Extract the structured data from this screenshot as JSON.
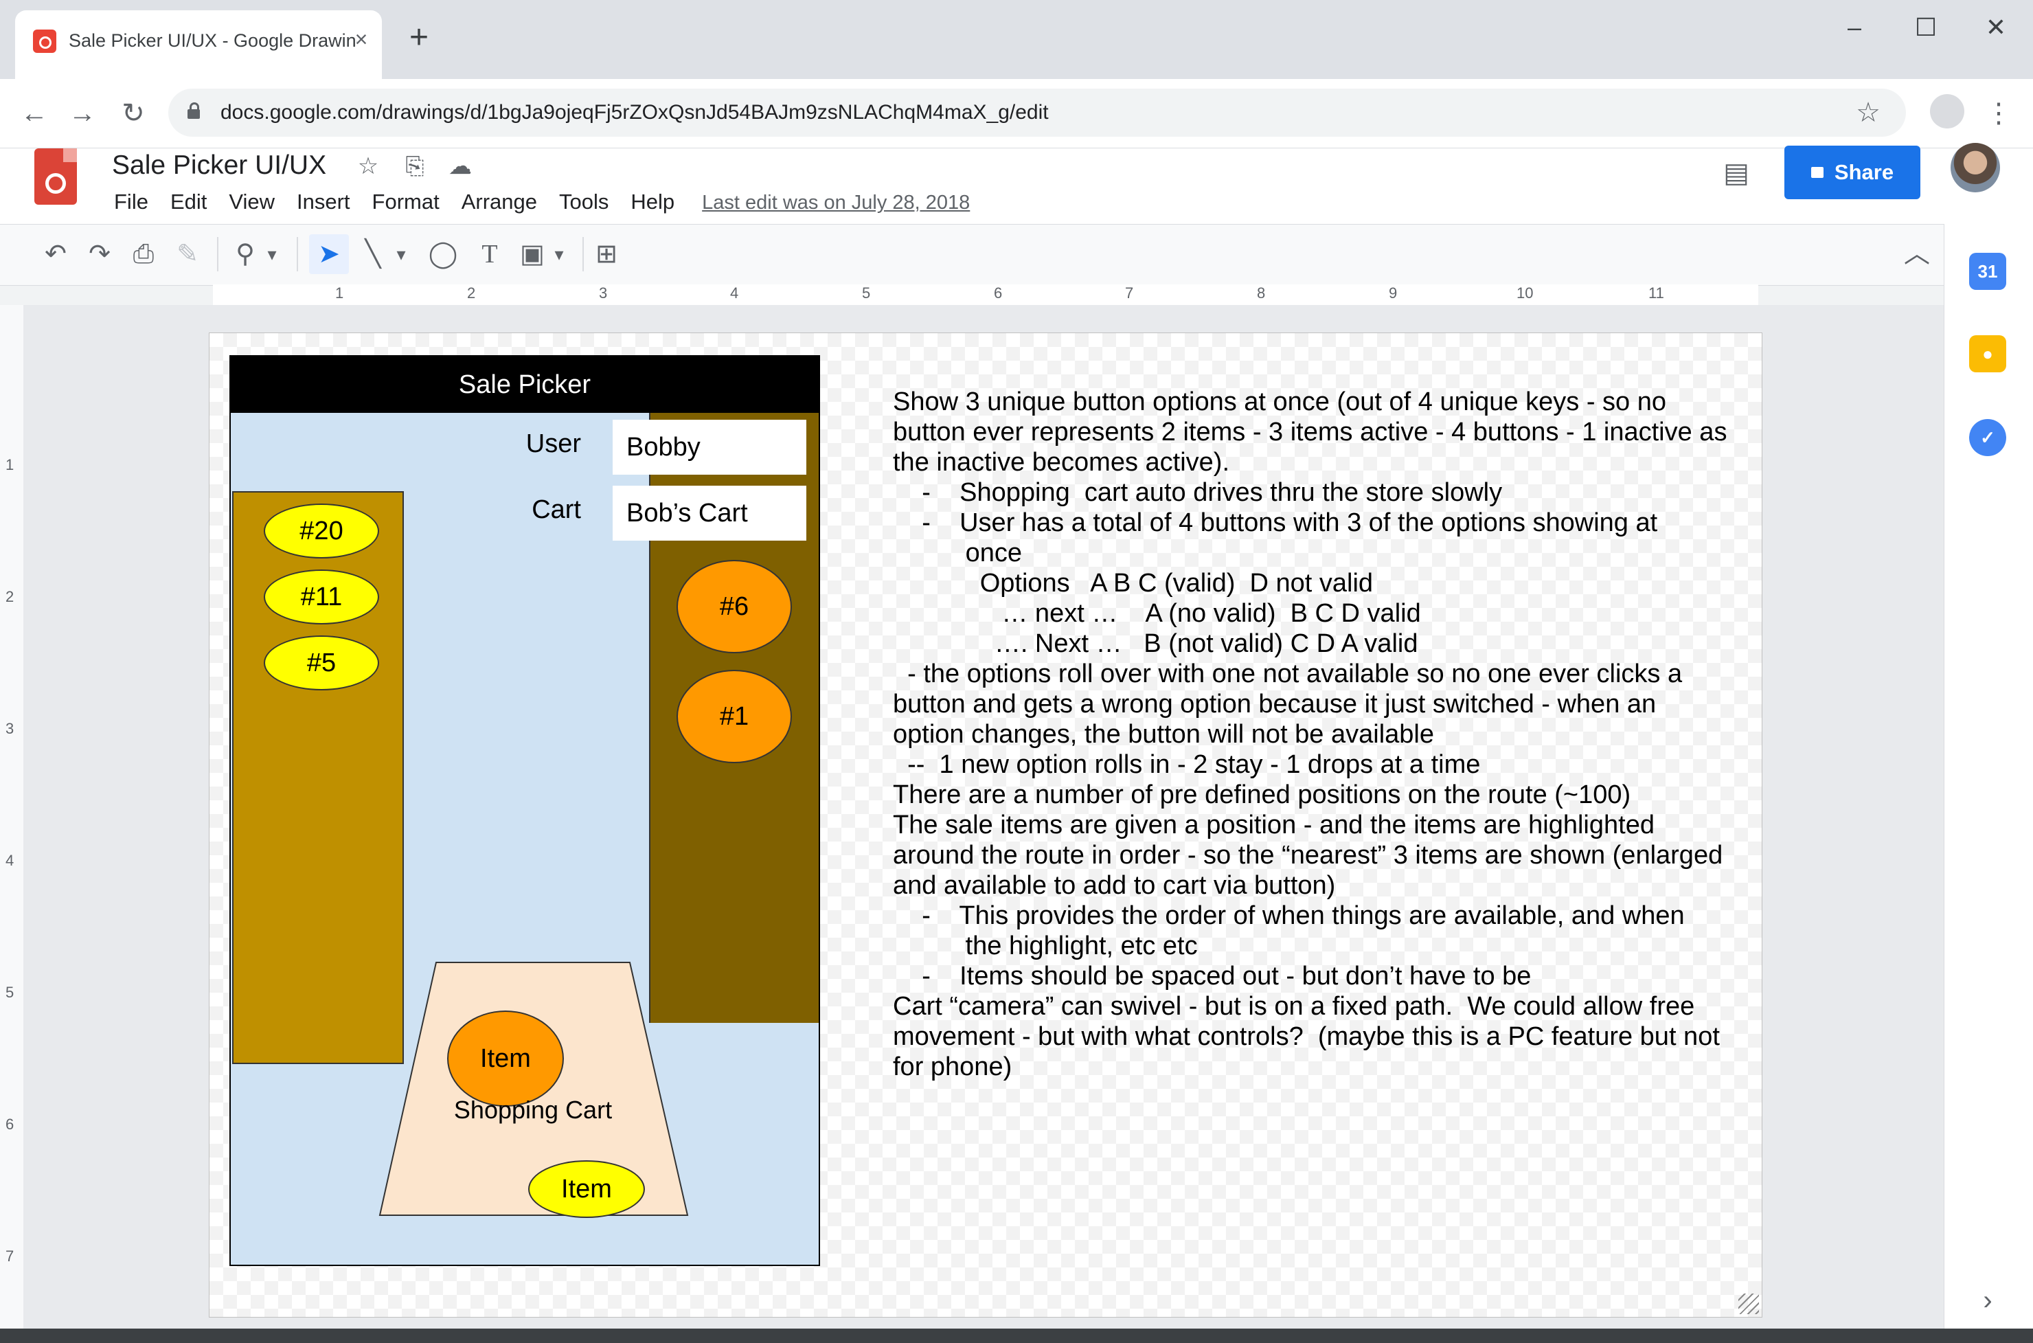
{
  "browser": {
    "tab_title": "Sale Picker UI/UX - Google Drawings",
    "tab_close": "×",
    "new_tab": "+",
    "url": "docs.google.com/drawings/d/1bgJa9ojeqFj5rZOxQsnJd54BAJm9zsNLAChqM4maX_g/edit",
    "window_controls": {
      "minimize": "–",
      "maximize": "☐",
      "close": "✕"
    },
    "nav": {
      "back": "←",
      "forward": "→",
      "reload": "↻"
    },
    "bookmark_icon": "☆",
    "menu_icon": "⋮"
  },
  "doc": {
    "title": "Sale Picker UI/UX",
    "menu": [
      "File",
      "Edit",
      "View",
      "Insert",
      "Format",
      "Arrange",
      "Tools",
      "Help"
    ],
    "last_edit": "Last edit was on July 28, 2018",
    "share_label": "Share",
    "icons": {
      "star": "☆",
      "move": "⎘",
      "cloud": "☁",
      "comments": "▤",
      "collapse": "︿"
    }
  },
  "toolbar": {
    "undo": "↶",
    "redo": "↷",
    "print": "⎙",
    "paint_format": "✎",
    "zoom": "⚲",
    "dropdown": "▾",
    "select": "➤",
    "line": "╲",
    "shape": "◯",
    "textbox": "T",
    "image": "▣",
    "comment": "⊞"
  },
  "side_panel": {
    "calendar": "31",
    "keep": "●",
    "tasks": "✓",
    "expand": "›"
  },
  "ruler": {
    "h": [
      "1",
      "2",
      "3",
      "4",
      "5",
      "6",
      "7",
      "8",
      "9",
      "10",
      "11"
    ],
    "v": [
      "1",
      "2",
      "3",
      "4",
      "5",
      "6",
      "7"
    ]
  },
  "wireframe": {
    "header": "Sale Picker",
    "user_label": "User",
    "user_value": "Bobby",
    "cart_label": "Cart",
    "cart_value": "Bob’s Cart",
    "left_items": [
      "#20",
      "#11",
      "#5"
    ],
    "right_items": [
      "#6",
      "#1"
    ],
    "cart_item_top": "Item",
    "cart_item_bottom": "Item",
    "cart_title": "Shopping Cart"
  },
  "notes": [
    "Show 3 unique button options at once (out of 4 unique keys - so no button ever represents 2 items - 3 items active - 4 buttons - 1 inactive as the inactive becomes active).",
    "",
    "    -    Shopping  cart auto drives thru the store slowly",
    "    -    User has a total of 4 buttons with 3 of the options showing at",
    "          once",
    "            Options   A B C (valid)  D not valid",
    "               … next …    A (no valid)  B C D valid",
    "              …. Next …   B (not valid) C D A valid",
    "  - the options roll over with one not available so no one ever clicks a button and gets a wrong option because it just switched - when an option changes, the button will not be available",
    "  --  1 new option rolls in - 2 stay - 1 drops at a time",
    "",
    "There are a number of pre defined positions on the route (~100)",
    "The sale items are given a position - and the items are highlighted around the route in order - so the “nearest” 3 items are shown (enlarged and available to add to cart via button)",
    "    -    This provides the order of when things are available, and when",
    "          the highlight, etc etc",
    "    -    Items should be spaced out - but don’t have to be",
    "",
    "Cart “camera” can swivel - but is on a fixed path.  We could allow free movement - but with what controls?  (maybe this is a PC feature but not for phone)"
  ]
}
